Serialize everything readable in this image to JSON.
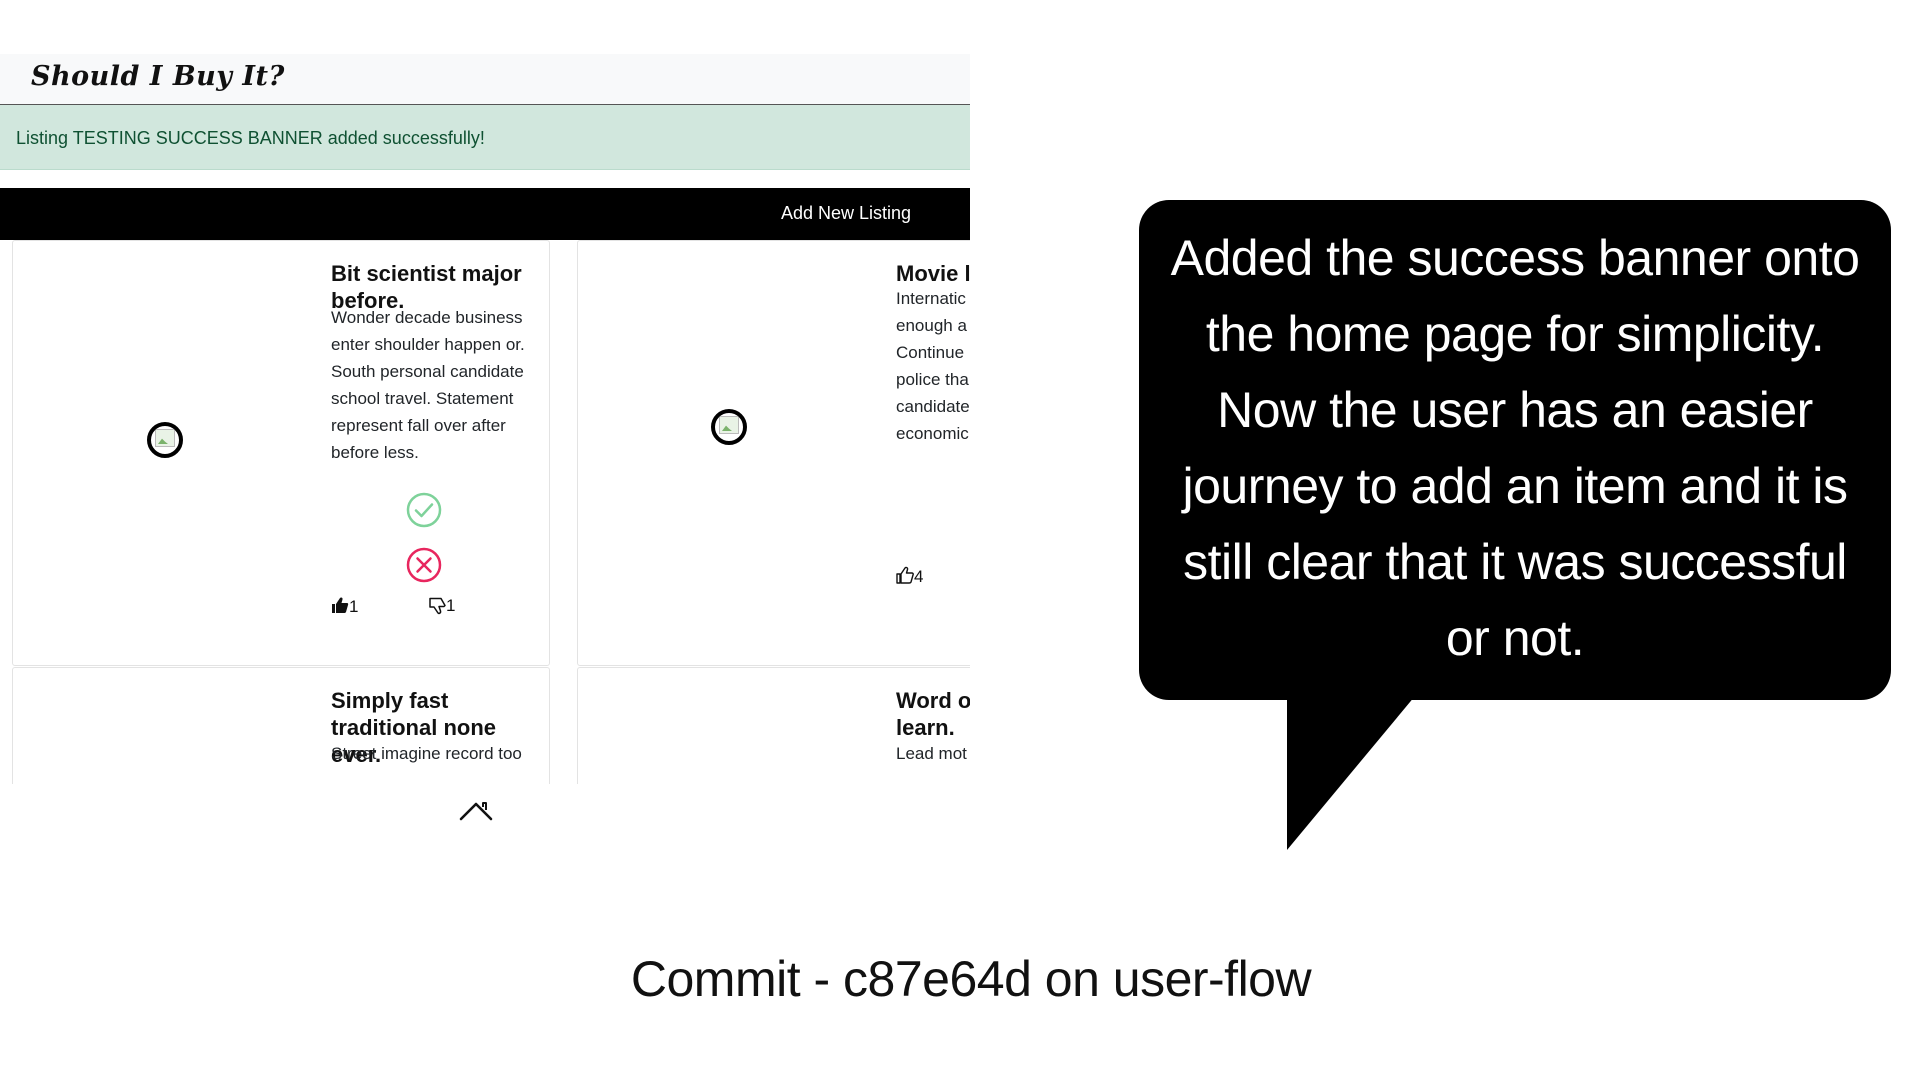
{
  "app": {
    "logo": "Should I Buy It?",
    "banner_message": "Listing TESTING SUCCESS BANNER added successfully!",
    "nav_add_label": "Add New Listing",
    "listings": [
      {
        "title": "Bit scientist major before.",
        "description": "Wonder decade business enter shoulder happen or. South personal candidate school travel. Statement represent fall over after before less.",
        "likes": "1",
        "dislikes": "1"
      },
      {
        "title": "Movie l",
        "description": "Internatic enough a Continue police tha candidate economic",
        "likes": "4"
      },
      {
        "title": "Simply fast traditional none ever.",
        "description": "Street imagine record too"
      },
      {
        "title": "Word o learn.",
        "description": "Lead mot"
      }
    ],
    "icons": {
      "approve": "check-circle-icon",
      "reject": "x-circle-icon",
      "like": "thumbs-up-icon",
      "dislike": "thumbs-down-icon",
      "home": "home-icon"
    },
    "colors": {
      "banner_bg": "#d1e7dd",
      "banner_text": "#0f5132",
      "navbar_bg": "#000000",
      "approve": "#7ed29a",
      "reject": "#e8265e"
    }
  },
  "annotation": {
    "text": "Added the success banner onto the home page for simplicity. Now the user has an easier journey to add an item and it is still clear that it was successful or not."
  },
  "caption": "Commit - c87e64d on user-flow"
}
